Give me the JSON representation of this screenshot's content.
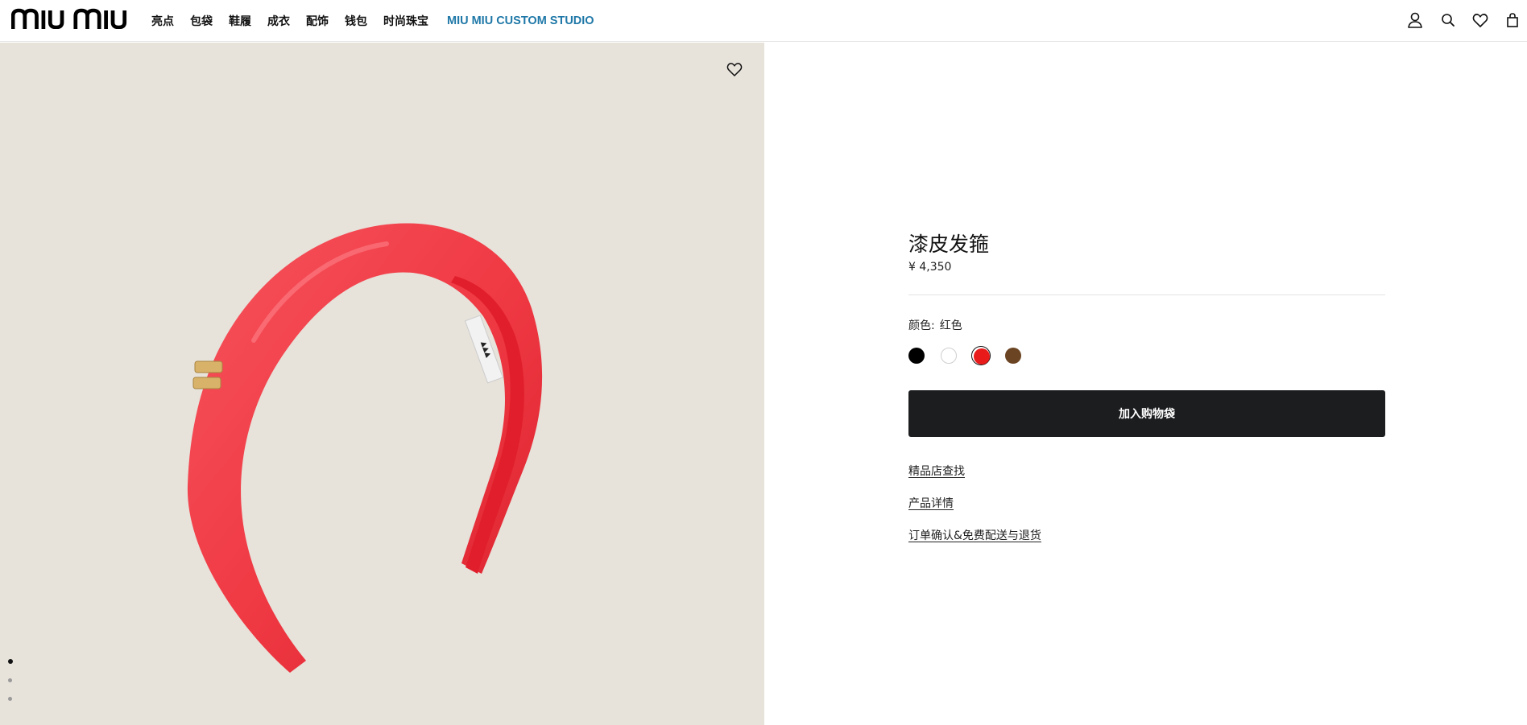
{
  "brand": {
    "logo_text": "MIU MIU"
  },
  "nav": {
    "items": [
      "亮点",
      "包袋",
      "鞋履",
      "成衣",
      "配饰",
      "钱包",
      "时尚珠宝"
    ],
    "studio_label": "MIU MIU CUSTOM STUDIO",
    "studio_color": "#1f78a8"
  },
  "header_icons": [
    "user-icon",
    "search-icon",
    "heart-icon",
    "shopping-bag-icon"
  ],
  "gallery": {
    "background_color": "#e7e2da",
    "product_color": "#f0303c",
    "image_count": 3,
    "active_index": 0
  },
  "product": {
    "title": "漆皮发箍",
    "price": "¥ 4,350",
    "color_label": "颜色:",
    "color_value": "红色",
    "swatches": [
      {
        "color": "#000000",
        "selected": false
      },
      {
        "color": "#ffffff",
        "selected": false
      },
      {
        "color": "#e81a1a",
        "selected": true
      },
      {
        "color": "#6b4423",
        "selected": false
      }
    ],
    "add_to_bag": "加入购物袋",
    "links": [
      "精品店查找",
      "产品详情",
      "订单确认&免费配送与退货"
    ]
  }
}
